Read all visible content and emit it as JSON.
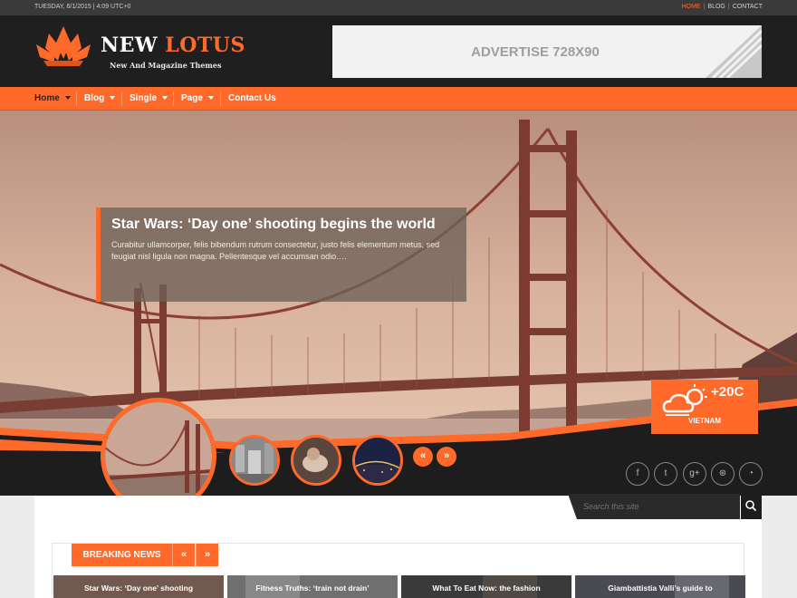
{
  "topbar": {
    "date": "TUESDAY, 6/1/2015 | 4:09 UTC+0",
    "links": [
      {
        "label": "HOME",
        "active": true
      },
      {
        "label": "BLOG",
        "active": false
      },
      {
        "label": "CONTACT",
        "active": false
      }
    ]
  },
  "header": {
    "logo_first": "NEW",
    "logo_second": "LOTUS",
    "tagline": "New And Magazine Themes",
    "ad_text": "ADVERTISE 728X90"
  },
  "nav": {
    "items": [
      {
        "label": "Home",
        "dropdown": true,
        "active": true
      },
      {
        "label": "Blog",
        "dropdown": true,
        "active": false
      },
      {
        "label": "Single",
        "dropdown": true,
        "active": false
      },
      {
        "label": "Page",
        "dropdown": true,
        "active": false
      },
      {
        "label": "Contact Us",
        "dropdown": false,
        "active": false
      }
    ]
  },
  "hero": {
    "title": "Star Wars: ‘Day one’ shooting begins the world",
    "excerpt": "Curabitur ullamcorper, felis bibendum rutrum consectetur, justo felis elementum metus, sed feugiat nisl ligula non magna. Pellentesque vel accumsan odio…."
  },
  "weather": {
    "temperature": "+20C",
    "location": "VIETNAM",
    "icon": "cloud-sun-icon"
  },
  "slider": {
    "prev_label": "«",
    "next_label": "»"
  },
  "social": [
    {
      "icon": "facebook-icon",
      "glyph": "f"
    },
    {
      "icon": "twitter-icon",
      "glyph": "t"
    },
    {
      "icon": "google-plus-icon",
      "glyph": "g+"
    },
    {
      "icon": "dribbble-icon",
      "glyph": "⊛"
    },
    {
      "icon": "rss-icon",
      "glyph": "◔"
    }
  ],
  "search": {
    "placeholder": "Search this site",
    "icon": "search-icon"
  },
  "breaking": {
    "label": "BREAKING NEWS",
    "prev": "«",
    "next": "»",
    "cards": [
      {
        "title": "Star Wars: ‘Day one’ shooting"
      },
      {
        "title": "Fitness Truths: ‘train not drain’"
      },
      {
        "title": "What To Eat Now: the fashion"
      },
      {
        "title": "Giambattistia Valli’s guide to"
      }
    ]
  },
  "colors": {
    "accent": "#ff6a2b",
    "dark": "#1f1f1f",
    "topbar": "#3a3a3a"
  }
}
